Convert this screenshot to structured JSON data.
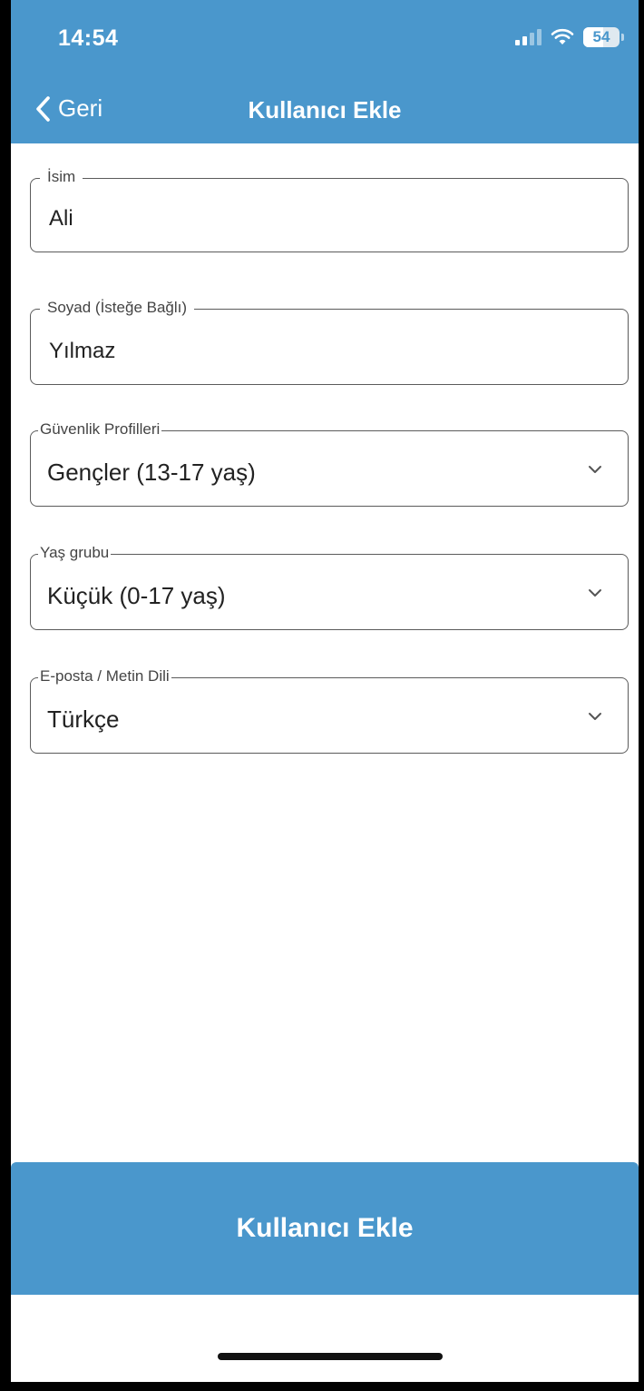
{
  "status_bar": {
    "time": "14:54",
    "battery": "54"
  },
  "nav": {
    "back_label": "Geri",
    "title": "Kullanıcı Ekle"
  },
  "form": {
    "first_name": {
      "label": "İsim",
      "value": "Ali"
    },
    "last_name": {
      "label": "Soyad (İsteğe Bağlı)",
      "value": "Yılmaz"
    },
    "security_profile": {
      "label": "Güvenlik Profilleri",
      "selected": "Gençler (13-17 yaş)"
    },
    "age_group": {
      "label": "Yaş grubu",
      "selected": "Küçük (0-17 yaş)"
    },
    "language": {
      "label": "E-posta / Metin Dili",
      "selected": "Türkçe"
    }
  },
  "footer": {
    "submit_label": "Kullanıcı Ekle"
  },
  "colors": {
    "accent": "#4a97cc",
    "border": "#5b5b5b"
  }
}
